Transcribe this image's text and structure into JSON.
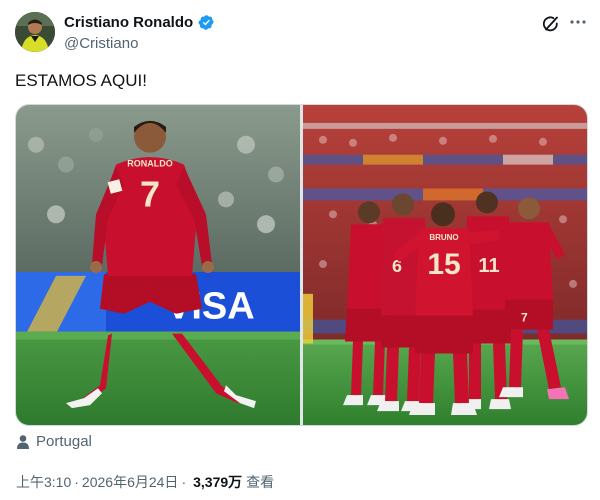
{
  "author": {
    "display_name": "Cristiano Ronaldo",
    "handle": "@Cristiano",
    "verified": true,
    "verified_color": "#1d9bf0"
  },
  "actions": {
    "grok_icon": "grok-icon",
    "more_icon": "more-horizontal-icon"
  },
  "tweet": {
    "text": "ESTAMOS AQUI!"
  },
  "media": {
    "left_photo": {
      "jersey_name": "RONALDO",
      "jersey_number": "7",
      "board_text": "VISA"
    },
    "right_photo": {
      "numbers": [
        "6",
        "15",
        "11",
        "7"
      ],
      "jersey_name": "BRUNO"
    }
  },
  "location": {
    "icon": "person-location-icon",
    "text": "Portugal"
  },
  "meta": {
    "time": "上午3:10",
    "separator": "·",
    "date": "2026年6月24日",
    "views_count": "3,379万",
    "views_label": "查看"
  },
  "colors": {
    "text_primary": "#0f1419",
    "text_secondary": "#536471",
    "jersey_red": "#c8102e",
    "pitch_green": "#3f8a3a"
  }
}
